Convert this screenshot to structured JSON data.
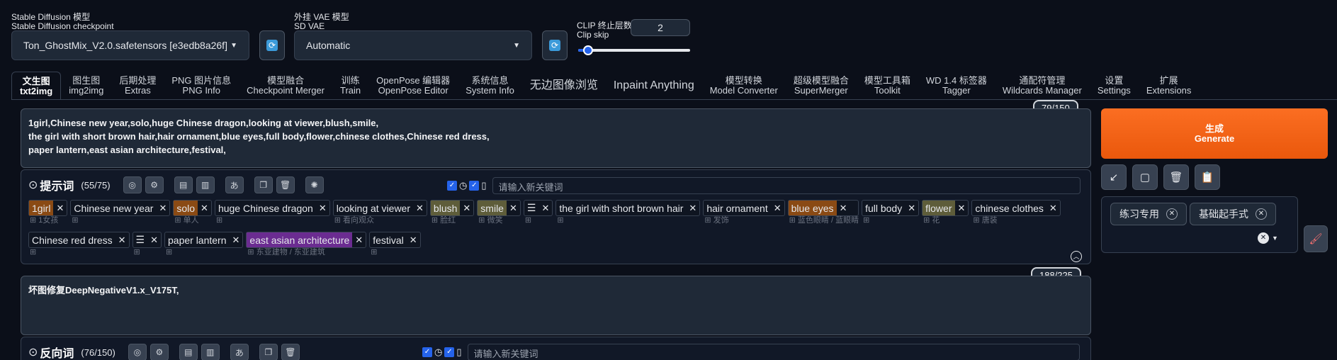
{
  "top": {
    "checkpoint_label_cn": "Stable Diffusion 模型",
    "checkpoint_label_en": "Stable Diffusion checkpoint",
    "checkpoint_value": "Ton_GhostMix_V2.0.safetensors [e3edb8a26f]",
    "vae_label_cn": "外挂 VAE 模型",
    "vae_label_en": "SD VAE",
    "vae_value": "Automatic",
    "clip_label_cn": "CLIP 终止层数",
    "clip_label_en": "Clip skip",
    "clip_value": "2",
    "clip_slider_fraction": 0.09
  },
  "tabs": [
    {
      "cn": "文生图",
      "en": "txt2img"
    },
    {
      "cn": "图生图",
      "en": "img2img"
    },
    {
      "cn": "后期处理",
      "en": "Extras"
    },
    {
      "cn": "PNG 图片信息",
      "en": "PNG Info"
    },
    {
      "cn": "模型融合",
      "en": "Checkpoint Merger"
    },
    {
      "cn": "训练",
      "en": "Train"
    },
    {
      "cn": "OpenPose 编辑器",
      "en": "OpenPose Editor"
    },
    {
      "cn": "系统信息",
      "en": "System Info"
    },
    {
      "cn": "无边图像浏览",
      "en": ""
    },
    {
      "cn": "Inpaint Anything",
      "en": ""
    },
    {
      "cn": "模型转换",
      "en": "Model Converter"
    },
    {
      "cn": "超级模型融合",
      "en": "SuperMerger"
    },
    {
      "cn": "模型工具箱",
      "en": "Toolkit"
    },
    {
      "cn": "WD 1.4 标签器",
      "en": "Tagger"
    },
    {
      "cn": "通配符管理",
      "en": "Wildcards Manager"
    },
    {
      "cn": "设置",
      "en": "Settings"
    },
    {
      "cn": "扩展",
      "en": "Extensions"
    }
  ],
  "prompt": {
    "counter": "79/150",
    "lines": [
      "1girl,Chinese new year,solo,huge Chinese dragon,looking at viewer,blush,smile,",
      "the girl with short brown hair,hair ornament,blue eyes,full body,flower,chinese clothes,Chinese red dress,",
      "paper lantern,east asian architecture,festival,"
    ],
    "section_label": "提示词",
    "section_count": "(55/75)",
    "keyword_placeholder": "请输入新关键词"
  },
  "tags_row1": [
    {
      "text": "1girl",
      "sub": "1女孩",
      "color": "#8a4a14"
    },
    {
      "text": "Chinese new year",
      "sub": "",
      "color": ""
    },
    {
      "text": "solo",
      "sub": "单人",
      "color": "#8a4a14"
    },
    {
      "text": "huge Chinese dragon",
      "sub": "",
      "color": ""
    },
    {
      "text": "looking at viewer",
      "sub": "看向观众",
      "color": ""
    },
    {
      "text": "blush",
      "sub": "脸红",
      "color": "#5e5d3a"
    },
    {
      "text": "smile",
      "sub": "微笑",
      "color": "#5e5d3a"
    },
    {
      "text": "☰",
      "sub": "",
      "color": ""
    },
    {
      "text": "the girl with short brown hair",
      "sub": "",
      "color": ""
    },
    {
      "text": "hair ornament",
      "sub": "发饰",
      "color": ""
    },
    {
      "text": "blue eyes",
      "sub": "蓝色眼睛 / 蓝眼睛",
      "color": "#8a4a14"
    },
    {
      "text": "full body",
      "sub": "",
      "color": ""
    },
    {
      "text": "flower",
      "sub": "花",
      "color": "#5e5d3a"
    },
    {
      "text": "chinese clothes",
      "sub": "唐装",
      "color": ""
    }
  ],
  "tags_row2": [
    {
      "text": "Chinese red dress",
      "sub": "",
      "color": ""
    },
    {
      "text": "☰",
      "sub": "",
      "color": ""
    },
    {
      "text": "paper lantern",
      "sub": "",
      "color": ""
    },
    {
      "text": "east asian architecture",
      "sub": "东亚建物 / 东亚建筑",
      "color": "#6b2c91"
    },
    {
      "text": "festival",
      "sub": "",
      "color": ""
    }
  ],
  "negative": {
    "counter": "188/225",
    "text": "坏图修复DeepNegativeV1.x_V175T,",
    "section_label": "反向词",
    "section_count": "(76/150)",
    "keyword_placeholder": "请输入新关键词"
  },
  "generate": {
    "cn": "生成",
    "en": "Generate"
  },
  "styles": {
    "chip1": "练习专用",
    "chip2": "基础起手式"
  }
}
